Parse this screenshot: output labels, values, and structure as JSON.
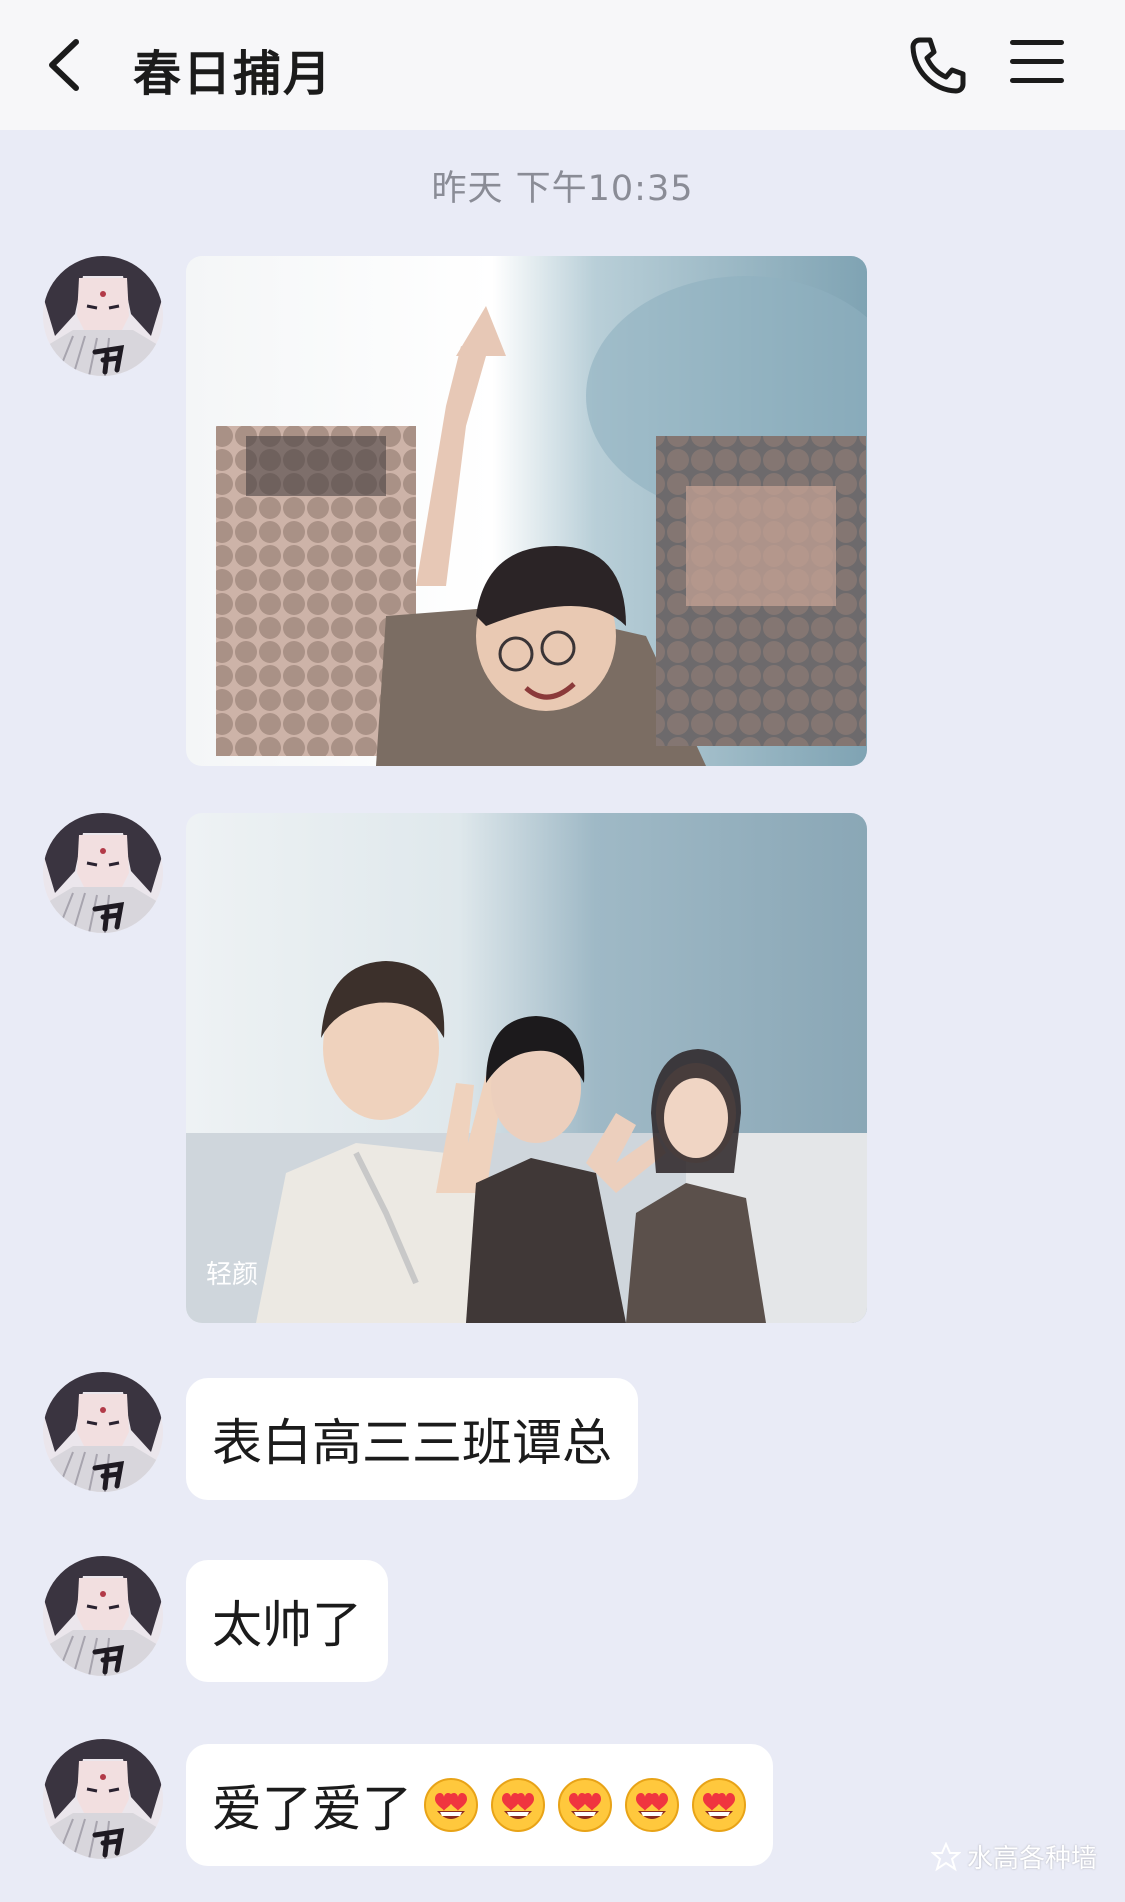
{
  "header": {
    "title": "春日捕月"
  },
  "timestamp": "昨天 下午10:35",
  "messages": [
    {
      "kind": "image"
    },
    {
      "kind": "image"
    },
    {
      "kind": "text",
      "text": "表白高三三班谭总"
    },
    {
      "kind": "text",
      "text": "太帅了"
    },
    {
      "kind": "text",
      "text": "爱了爱了",
      "emoji": "smiling-face-with-heart-eyes",
      "emoji_count": 5
    }
  ],
  "photo2_watermark": "轻颜",
  "watermark": "水高各种墙"
}
